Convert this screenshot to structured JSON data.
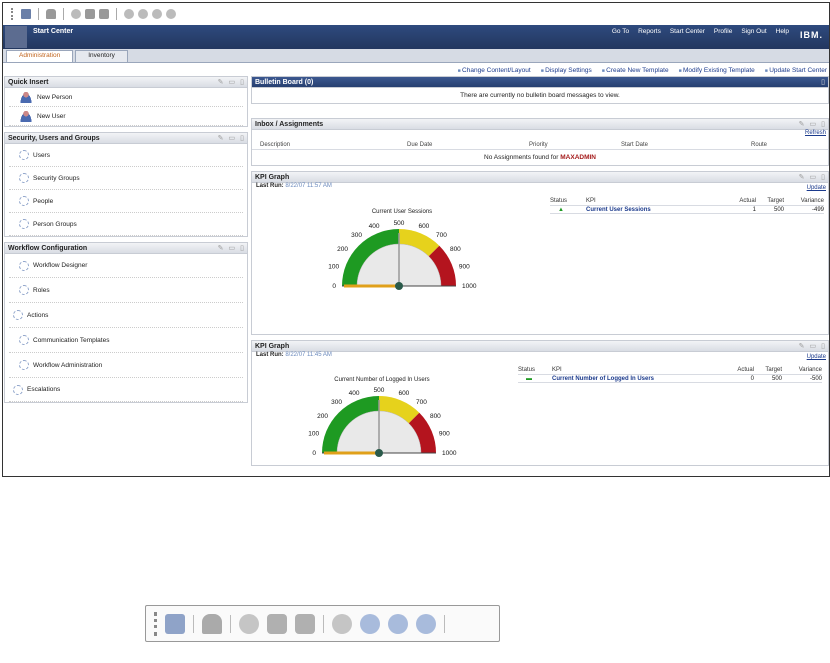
{
  "header": {
    "app_title": "Start Center",
    "links": [
      "Go To",
      "Reports",
      "Start Center",
      "Profile",
      "Sign Out",
      "Help"
    ],
    "brand": "IBM."
  },
  "tabs": [
    "Administration",
    "Inventory"
  ],
  "actions": [
    "Change Content/Layout",
    "Display Settings",
    "Create New Template",
    "Modify Existing Template",
    "Update Start Center"
  ],
  "quick_insert": {
    "title": "Quick Insert",
    "items": [
      "New Person",
      "New User"
    ]
  },
  "security": {
    "title": "Security, Users and Groups",
    "items": [
      "Users",
      "Security Groups",
      "People",
      "Person Groups"
    ]
  },
  "workflow": {
    "title": "Workflow Configuration",
    "items": [
      "Workflow Designer",
      "Roles",
      "Actions",
      "Communication Templates",
      "Workflow Administration",
      "Escalations"
    ]
  },
  "bulletin": {
    "title": "Bulletin Board (0)",
    "message": "There are currently no bulletin board messages to view."
  },
  "inbox": {
    "title": "Inbox / Assignments",
    "refresh": "Refresh",
    "columns": [
      "Description",
      "Due Date",
      "Priority",
      "Start Date",
      "Route"
    ],
    "empty_prefix": "No Assignments found for",
    "user": "MAXADMIN"
  },
  "kpi1": {
    "title": "KPI Graph",
    "last_run_label": "Last Run:",
    "last_run": "8/22/07 11:57 AM",
    "update": "Update",
    "gauge_title": "Current User Sessions",
    "columns": [
      "Status",
      "KPI",
      "Actual",
      "Target",
      "Variance"
    ],
    "row": {
      "kpi": "Current User Sessions",
      "actual": "1",
      "target": "500",
      "variance": "-499"
    }
  },
  "kpi2": {
    "title": "KPI Graph",
    "last_run_label": "Last Run:",
    "last_run": "8/22/07 11:45 AM",
    "update": "Update",
    "gauge_title": "Current Number of Logged In Users",
    "columns": [
      "Status",
      "KPI",
      "Actual",
      "Target",
      "Variance"
    ],
    "row": {
      "kpi": "Current Number of Logged In Users",
      "actual": "0",
      "target": "500",
      "variance": "-500"
    }
  },
  "gauge_ticks": [
    "0",
    "100",
    "200",
    "300",
    "400",
    "500",
    "600",
    "700",
    "800",
    "900",
    "1000"
  ],
  "colors": {
    "header": "#2e4a7e",
    "gauge_green": "#1e9a22",
    "gauge_yellow": "#e6d21c",
    "gauge_red": "#b4141e",
    "link": "#1b3a8c",
    "accent": "#c0631c"
  }
}
